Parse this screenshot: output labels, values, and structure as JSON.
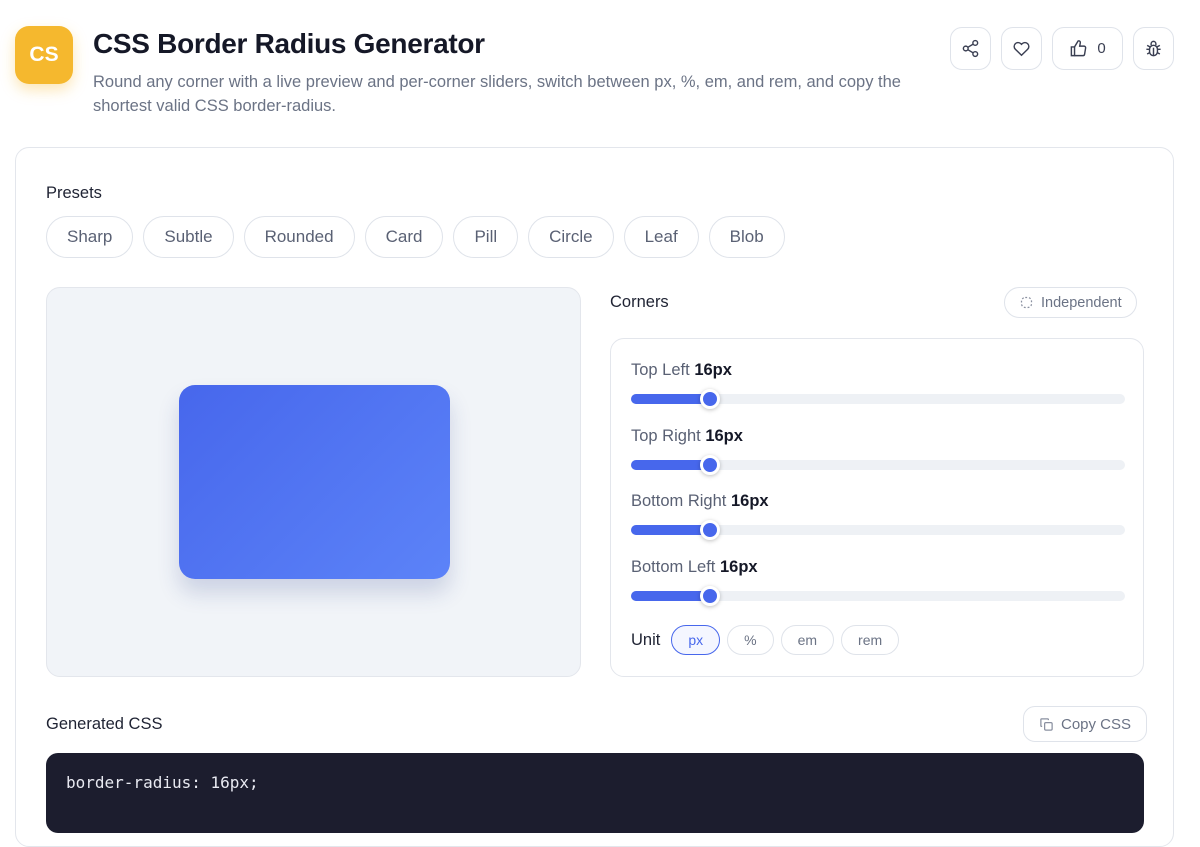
{
  "app": {
    "logo_text": "CS",
    "title": "CSS Border Radius Generator",
    "subtitle": "Round any corner with a live preview and per-corner sliders, switch between px, %, em, and rem, and copy the shortest valid CSS border-radius.",
    "like_count": "0",
    "colors": {
      "logo": "#f5b82e",
      "accent": "#4767ec",
      "code_bg": "#1c1d2e"
    },
    "header_icons": [
      "share-icon",
      "heart-icon",
      "thumbs-up-icon",
      "bug-icon"
    ]
  },
  "presets": {
    "label": "Presets",
    "items": [
      "Sharp",
      "Subtle",
      "Rounded",
      "Card",
      "Pill",
      "Circle",
      "Leaf",
      "Blob"
    ]
  },
  "corners": {
    "label": "Corners",
    "mode_button": "Independent",
    "slider_max": 100,
    "items": [
      {
        "label": "Top Left",
        "value_text": "16px",
        "value": 16
      },
      {
        "label": "Top Right",
        "value_text": "16px",
        "value": 16
      },
      {
        "label": "Bottom Right",
        "value_text": "16px",
        "value": 16
      },
      {
        "label": "Bottom Left",
        "value_text": "16px",
        "value": 16
      }
    ],
    "unit_label": "Unit",
    "units": [
      "px",
      "%",
      "em",
      "rem"
    ],
    "selected_unit": "px"
  },
  "output": {
    "label": "Generated CSS",
    "copy_label": "Copy CSS",
    "code": "border-radius: 16px;"
  }
}
